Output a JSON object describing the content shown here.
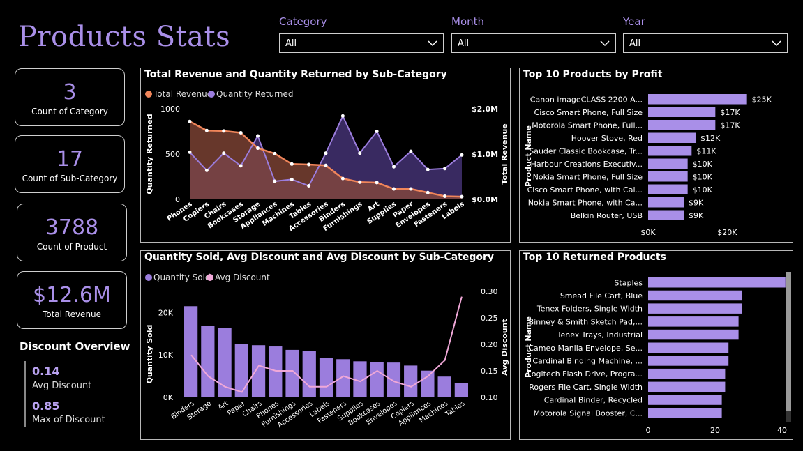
{
  "header": {
    "title": "Products Stats"
  },
  "filters": [
    {
      "label": "Category",
      "value": "All"
    },
    {
      "label": "Month",
      "value": "All"
    },
    {
      "label": "Year",
      "value": "All"
    }
  ],
  "kpis": [
    {
      "value": "3",
      "label": "Count of Category"
    },
    {
      "value": "17",
      "label": "Count of Sub-Category"
    },
    {
      "value": "3788",
      "label": "Count of Product"
    },
    {
      "value": "$12.6M",
      "label": "Total Revenue"
    }
  ],
  "discount": {
    "heading": "Discount Overview",
    "avg_value": "0.14",
    "avg_label": "Avg Discount",
    "max_value": "0.85",
    "max_label": "Max of Discount"
  },
  "colors": {
    "accent": "#a98fe8",
    "purple": "#9b7ddd",
    "orange": "#f0855a",
    "pink": "#f0a8d8",
    "bar": "#a98fe8"
  },
  "chart_data": [
    {
      "type": "area",
      "title": "Total Revenue and Quantity Returned by Sub-Category",
      "ylabel": "Quantity Returned",
      "y2label": "Total Revenue",
      "legend": [
        "Total Revenue",
        "Quantity Returned"
      ],
      "ylim": [
        0,
        1000
      ],
      "y2lim": [
        0,
        2000000
      ],
      "yticks": [
        "1000",
        "500",
        "0"
      ],
      "y2ticks": [
        "$2.0M",
        "$1.0M",
        "$0.0M"
      ],
      "categories": [
        "Phones",
        "Copiers",
        "Chairs",
        "Bookcases",
        "Storage",
        "Appliances",
        "Machines",
        "Tables",
        "Accessories",
        "Binders",
        "Furnishings",
        "Art",
        "Supplies",
        "Paper",
        "Envelopes",
        "Fasteners",
        "Labels"
      ],
      "series": [
        {
          "name": "Total Revenue",
          "axis": "right",
          "values": [
            1720000,
            1520000,
            1510000,
            1470000,
            1130000,
            1010000,
            780000,
            770000,
            750000,
            460000,
            380000,
            370000,
            230000,
            230000,
            150000,
            70000,
            60000
          ]
        },
        {
          "name": "Quantity Returned",
          "axis": "left",
          "values": [
            520,
            320,
            510,
            370,
            700,
            200,
            220,
            150,
            510,
            920,
            510,
            750,
            360,
            530,
            330,
            340,
            490
          ]
        }
      ]
    },
    {
      "type": "bar",
      "title": "Top 10 Products by Profit",
      "ylabel": "Product Name",
      "xlim": [
        0,
        30000
      ],
      "xticks": [
        "$0K",
        "$20K"
      ],
      "categories": [
        "Canon imageCLASS 2200 A...",
        "Cisco Smart Phone, Full Size",
        "Motorola Smart Phone, Full...",
        "Hoover Stove, Red",
        "Sauder Classic Bookcase, Tr...",
        "Harbour Creations Executiv...",
        "Nokia Smart Phone, Full Size",
        "Cisco Smart Phone, with Cal...",
        "Nokia Smart Phone, with Ca...",
        "Belkin Router, USB"
      ],
      "values": [
        25000,
        17000,
        17000,
        12000,
        11000,
        10000,
        10000,
        10000,
        9000,
        9000
      ],
      "labels": [
        "$25K",
        "$17K",
        "$17K",
        "$12K",
        "$11K",
        "$10K",
        "$10K",
        "$10K",
        "$9K",
        "$9K"
      ]
    },
    {
      "type": "bar",
      "title": "Quantity Sold, Avg Discount and Avg Discount by Sub-Category",
      "ylabel": "Quantity Sold",
      "y2label": "Avg Discount",
      "legend": [
        "Quantity Sold",
        "Avg Discount"
      ],
      "ylim": [
        0,
        25000
      ],
      "y2lim": [
        0.1,
        0.3
      ],
      "yticks": [
        "20K",
        "10K",
        "0K"
      ],
      "y2ticks": [
        "0.30",
        "0.25",
        "0.20",
        "0.15",
        "0.10"
      ],
      "categories": [
        "Binders",
        "Storage",
        "Art",
        "Paper",
        "Chairs",
        "Phones",
        "Furnishings",
        "Accessories",
        "Labels",
        "Fasteners",
        "Supplies",
        "Bookcases",
        "Envelopes",
        "Copiers",
        "Appliances",
        "Machines",
        "Tables"
      ],
      "series": [
        {
          "name": "Quantity Sold",
          "type": "bar",
          "values": [
            21500,
            16800,
            16300,
            12500,
            12300,
            12000,
            11200,
            11000,
            9300,
            9000,
            8500,
            8300,
            8200,
            7500,
            6300,
            4900,
            3300
          ]
        },
        {
          "name": "Avg Discount",
          "type": "line",
          "values": [
            0.18,
            0.14,
            0.12,
            0.11,
            0.16,
            0.15,
            0.15,
            0.12,
            0.12,
            0.14,
            0.13,
            0.15,
            0.13,
            0.12,
            0.14,
            0.17,
            0.29
          ]
        }
      ]
    },
    {
      "type": "bar",
      "title": "Top 10 Returned Products",
      "ylabel": "Product Name",
      "xlim": [
        0,
        40
      ],
      "xticks": [
        "0",
        "20",
        "40"
      ],
      "categories": [
        "Staples",
        "Smead File Cart, Blue",
        "Tenex Folders, Single Width",
        "Binney & Smith Sketch Pad,...",
        "Tenex Trays, Industrial",
        "Cameo Manila Envelope, Se...",
        "Cardinal Binding Machine, ...",
        "Logitech Flash Drive, Progra...",
        "Rogers File Cart, Single Width",
        "Cardinal Binder, Recycled",
        "Motorola Signal Booster, C..."
      ],
      "values": [
        41,
        28,
        28,
        27,
        27,
        24,
        24,
        23,
        23,
        22,
        22
      ]
    }
  ]
}
